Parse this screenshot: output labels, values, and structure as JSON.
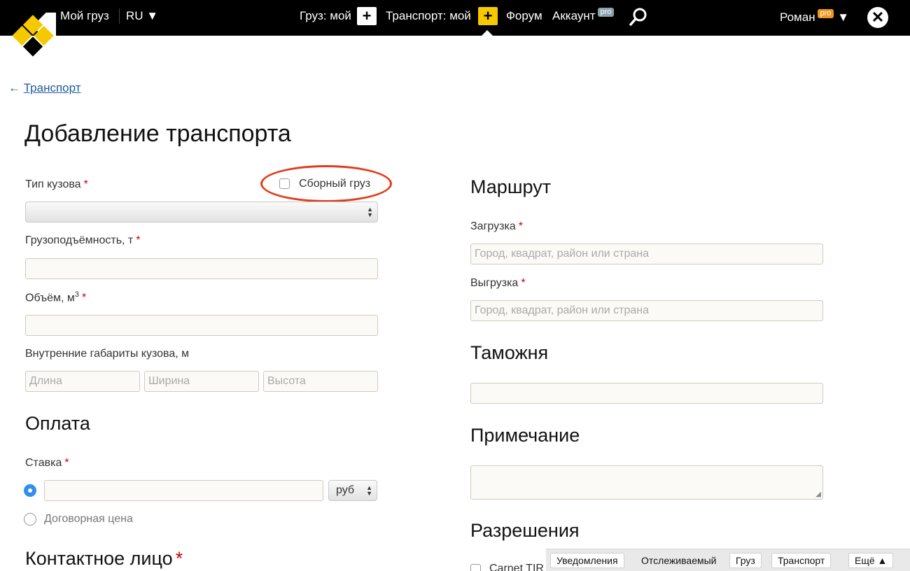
{
  "topbar": {
    "my_cargo": "Мой груз",
    "lang": "RU ▼",
    "cargo_label": "Груз: мой",
    "plus": "+",
    "transport_label": "Транспорт: мой",
    "forum": "Форум",
    "account": "Аккаунт",
    "pro_badge": "pro",
    "user": "Роман",
    "user_caret": "▼",
    "close": "✕"
  },
  "back": {
    "arrow": "←",
    "label": "Транспорт"
  },
  "page_title": "Добавление транспорта",
  "form": {
    "body_type_label": "Тип кузова",
    "consolidated_label": "Сборный груз",
    "capacity_label": "Грузоподъёмность, т",
    "volume_label": "Объём, м",
    "volume_sup": "3",
    "dims_label": "Внутренние габариты кузова, м",
    "length_placeholder": "Длина",
    "width_placeholder": "Ширина",
    "height_placeholder": "Высота",
    "required_mark": "*"
  },
  "payment": {
    "heading": "Оплата",
    "rate_label": "Ставка",
    "currency": "руб",
    "negotiable_label": "Договорная цена"
  },
  "contact": {
    "heading": "Контактное лицо"
  },
  "route": {
    "heading": "Маршрут",
    "loading_label": "Загрузка",
    "unloading_label": "Выгрузка",
    "placeholder": "Город, квадрат, район или страна"
  },
  "customs": {
    "heading": "Таможня"
  },
  "note": {
    "heading": "Примечание"
  },
  "permits": {
    "heading": "Разрешения",
    "first_item": "Carnet TIR"
  },
  "bottombar": {
    "notifications": "Уведомления",
    "tracked": "Отслеживаемый",
    "cargo": "Груз",
    "transport": "Транспорт",
    "more": "Ещё ▲"
  },
  "colors": {
    "accent_yellow": "#f5c800",
    "link_blue": "#1e5aa0",
    "highlight_red": "#e23b1a",
    "radio_blue": "#2f8fea"
  }
}
